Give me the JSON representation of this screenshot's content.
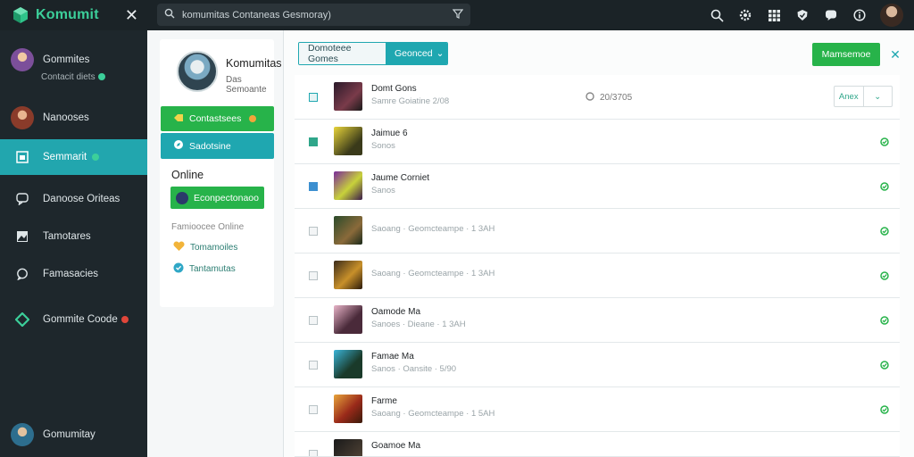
{
  "app": {
    "name": "Komumit"
  },
  "search": {
    "placeholder": "komumitas Contaneas Gesmoray)"
  },
  "sidebar": {
    "items": [
      {
        "label": "Gommites",
        "sub": "Contacit diets"
      },
      {
        "label": "Nanooses"
      },
      {
        "label": "Semmarit"
      },
      {
        "label": "Danoose Oriteas"
      },
      {
        "label": "Tamotares"
      },
      {
        "label": "Famasacies"
      },
      {
        "label": "Gommite Coode"
      },
      {
        "label": "Gomumitay"
      }
    ]
  },
  "profile": {
    "name": "Komumitas",
    "sub": "Das Semoante",
    "btn_primary": "Contastsees",
    "btn_secondary": "Sadotsine",
    "online_label": "Online",
    "online_btn": "Econpectonaoo",
    "online_sub": "Famioocee Online",
    "links": [
      "Tomamoiles",
      "Tantamutas"
    ]
  },
  "main": {
    "segment": [
      "Domoteee Gomes",
      "Geonced"
    ],
    "primary_btn": "Mamsemoe",
    "rows": [
      {
        "title": "Domt Gons",
        "sub": "Samre Goiatine 2/08",
        "mid": "20/3705",
        "pill_left": "Anex",
        "checked": "teal"
      },
      {
        "title": "Jaimue 6",
        "sub": "Sonos",
        "checked": "green"
      },
      {
        "title": "Jaume Corniet",
        "sub": "Sanos",
        "checked": "blue"
      },
      {
        "title": "",
        "sub": "Saoang · Geomcteampe · 1 3AH"
      },
      {
        "title": "",
        "sub": "Saoang · Geomcteampe · 1 3AH"
      },
      {
        "title": "Oamode Ma",
        "sub": "Sanoes · Dieane · 1 3AH"
      },
      {
        "title": "Famae Ma",
        "sub": "Sanos · Oansite · 5/90"
      },
      {
        "title": "Farme",
        "sub": "Saoang · Geomcteampe · 1 5AH"
      },
      {
        "title": "Goamoe Ma",
        "sub": ""
      }
    ]
  },
  "colors": {
    "accent": "#1fa7b0",
    "green": "#27b34a",
    "sidebar": "#1e272c",
    "topbar": "#1b2327",
    "brand": "#3ccf9a"
  }
}
